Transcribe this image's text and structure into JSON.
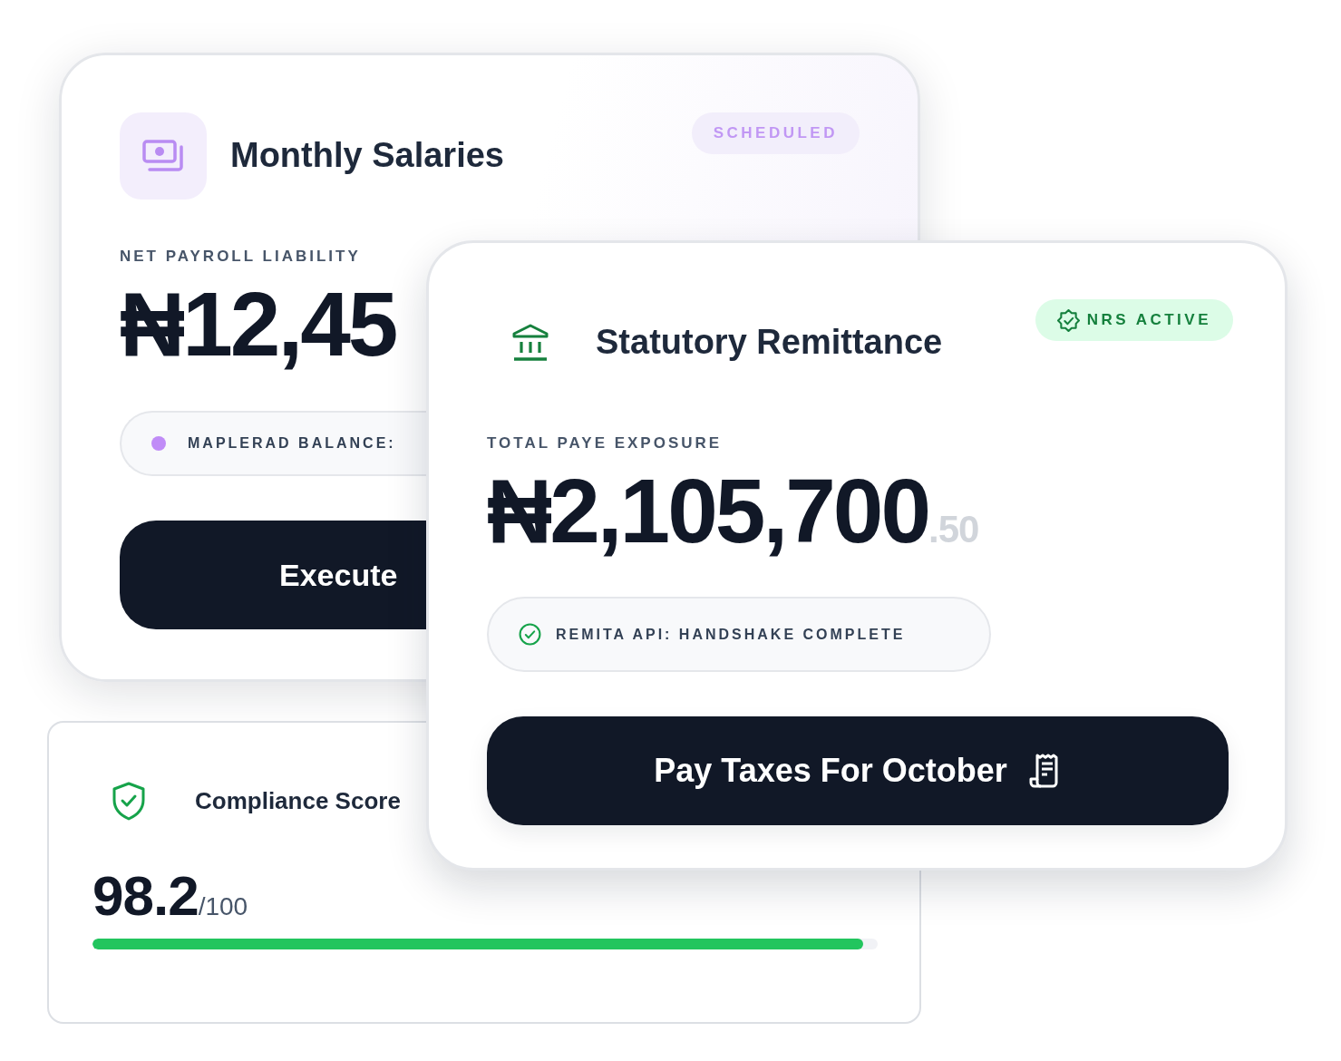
{
  "payroll_card": {
    "title": "Monthly Salaries",
    "status": "SCHEDULED",
    "amount_label": "NET PAYROLL LIABILITY",
    "amount": "₦12,45",
    "balance_label": "MAPLERAD BALANCE:",
    "action": "Execute"
  },
  "remittance_card": {
    "title": "Statutory Remittance",
    "status": "NRS ACTIVE",
    "amount_label": "TOTAL PAYE EXPOSURE",
    "amount": "₦2,105,700",
    "amount_decimals": ".50",
    "connection": "REMITA API: HANDSHAKE COMPLETE",
    "action": "Pay Taxes For October"
  },
  "compliance_card": {
    "title": "Compliance Score",
    "score": "98.2",
    "score_max": "/100",
    "level": 0.982
  }
}
